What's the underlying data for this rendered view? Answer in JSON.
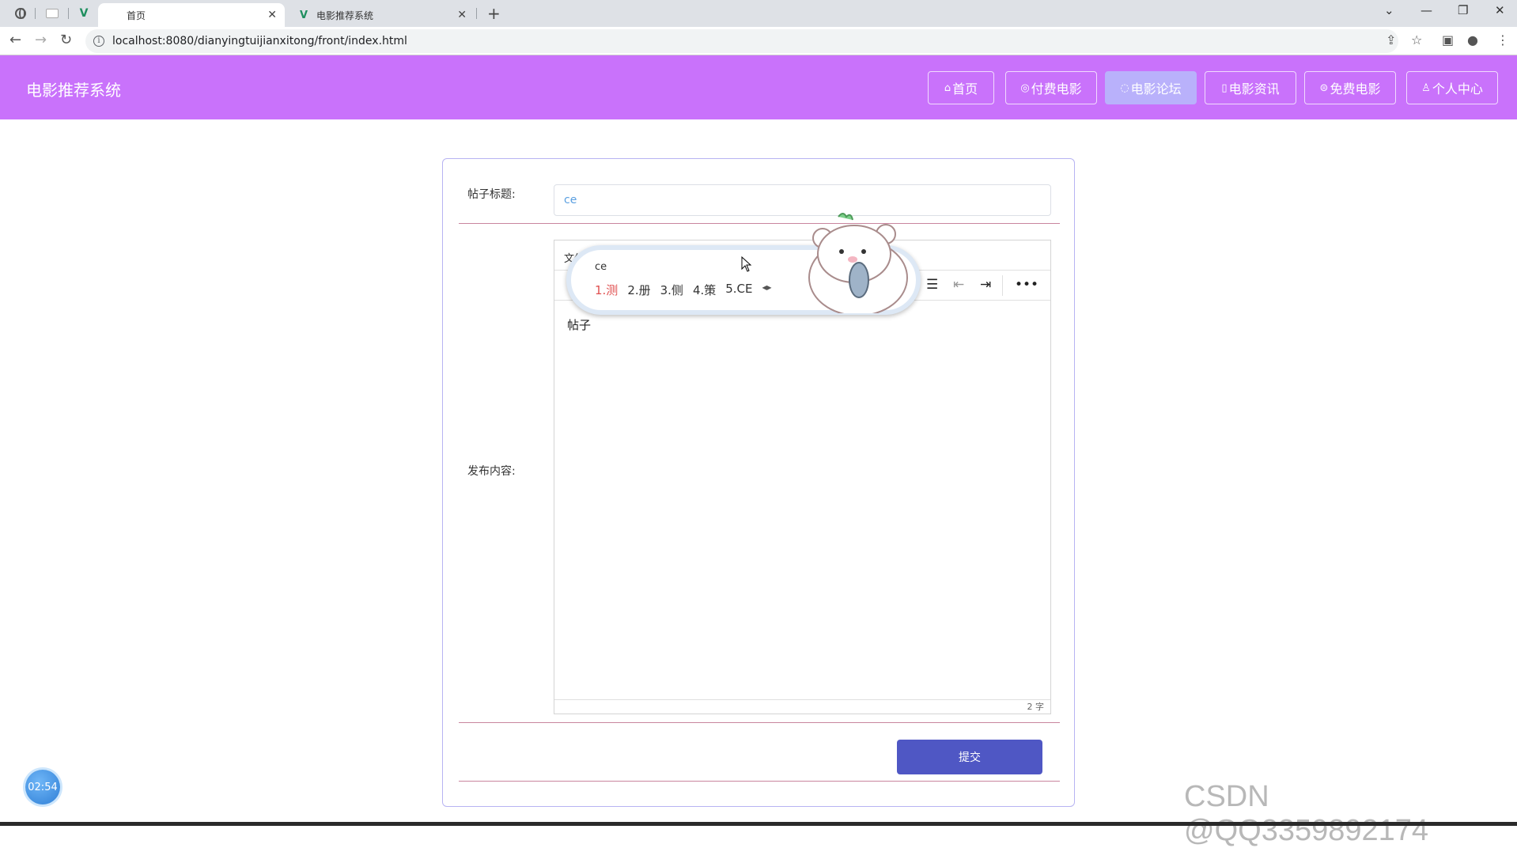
{
  "browser": {
    "tabs": [
      {
        "title": "首页",
        "active": true
      },
      {
        "title": "电影推荐系统",
        "active": false
      }
    ],
    "new_tab_label": "+",
    "url": "localhost:8080/dianyingtuijianxitong/front/index.html"
  },
  "site": {
    "title": "电影推荐系统",
    "nav": [
      {
        "label": "首页",
        "icon": "home-icon",
        "active": false
      },
      {
        "label": "付费电影",
        "icon": "paid-icon",
        "active": false
      },
      {
        "label": "电影论坛",
        "icon": "forum-icon",
        "active": true
      },
      {
        "label": "电影资讯",
        "icon": "news-icon",
        "active": false
      },
      {
        "label": "免费电影",
        "icon": "free-icon",
        "active": false
      },
      {
        "label": "个人中心",
        "icon": "user-icon",
        "active": false
      }
    ]
  },
  "form": {
    "title_label": "帖子标题:",
    "title_value": "ce",
    "content_label": "发布内容:",
    "editor_menu_label": "文件",
    "editor_content": "帖子",
    "word_count": "2 字",
    "submit_label": "提交"
  },
  "ime": {
    "preedit": "ce",
    "candidates": [
      "1.测",
      "2.册",
      "3.侧",
      "4.策",
      "5.CE"
    ],
    "arrows": "◂▸"
  },
  "overlay": {
    "timer": "02:54",
    "watermark": "CSDN @QQ3359892174"
  }
}
